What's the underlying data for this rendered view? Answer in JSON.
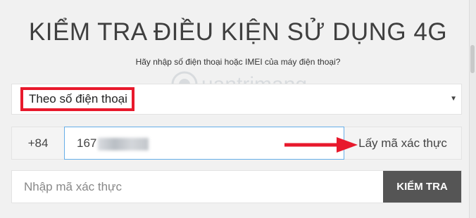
{
  "header": {
    "title": "KIỂM TRA ĐIỀU KIỆN SỬ DỤNG 4G",
    "subtitle": "Hãy nhập số điện thoại hoặc IMEI của máy điện thoại?"
  },
  "watermark": {
    "text": "uantrimang",
    "icon": "quantrimang-logo-icon"
  },
  "lookup_type": {
    "selected": "Theo số điện thoại",
    "highlight_color": "#e8192c"
  },
  "phone": {
    "country_code": "+84",
    "value_visible": "167"
  },
  "get_code_button": {
    "label": "Lấy mã xác thực"
  },
  "verification": {
    "placeholder": "Nhập mã xác thực"
  },
  "check_button": {
    "label": "KIỂM TRA"
  },
  "colors": {
    "annotation_red": "#e8192c",
    "input_focus_border": "#66aee8",
    "button_bg": "#555555"
  }
}
